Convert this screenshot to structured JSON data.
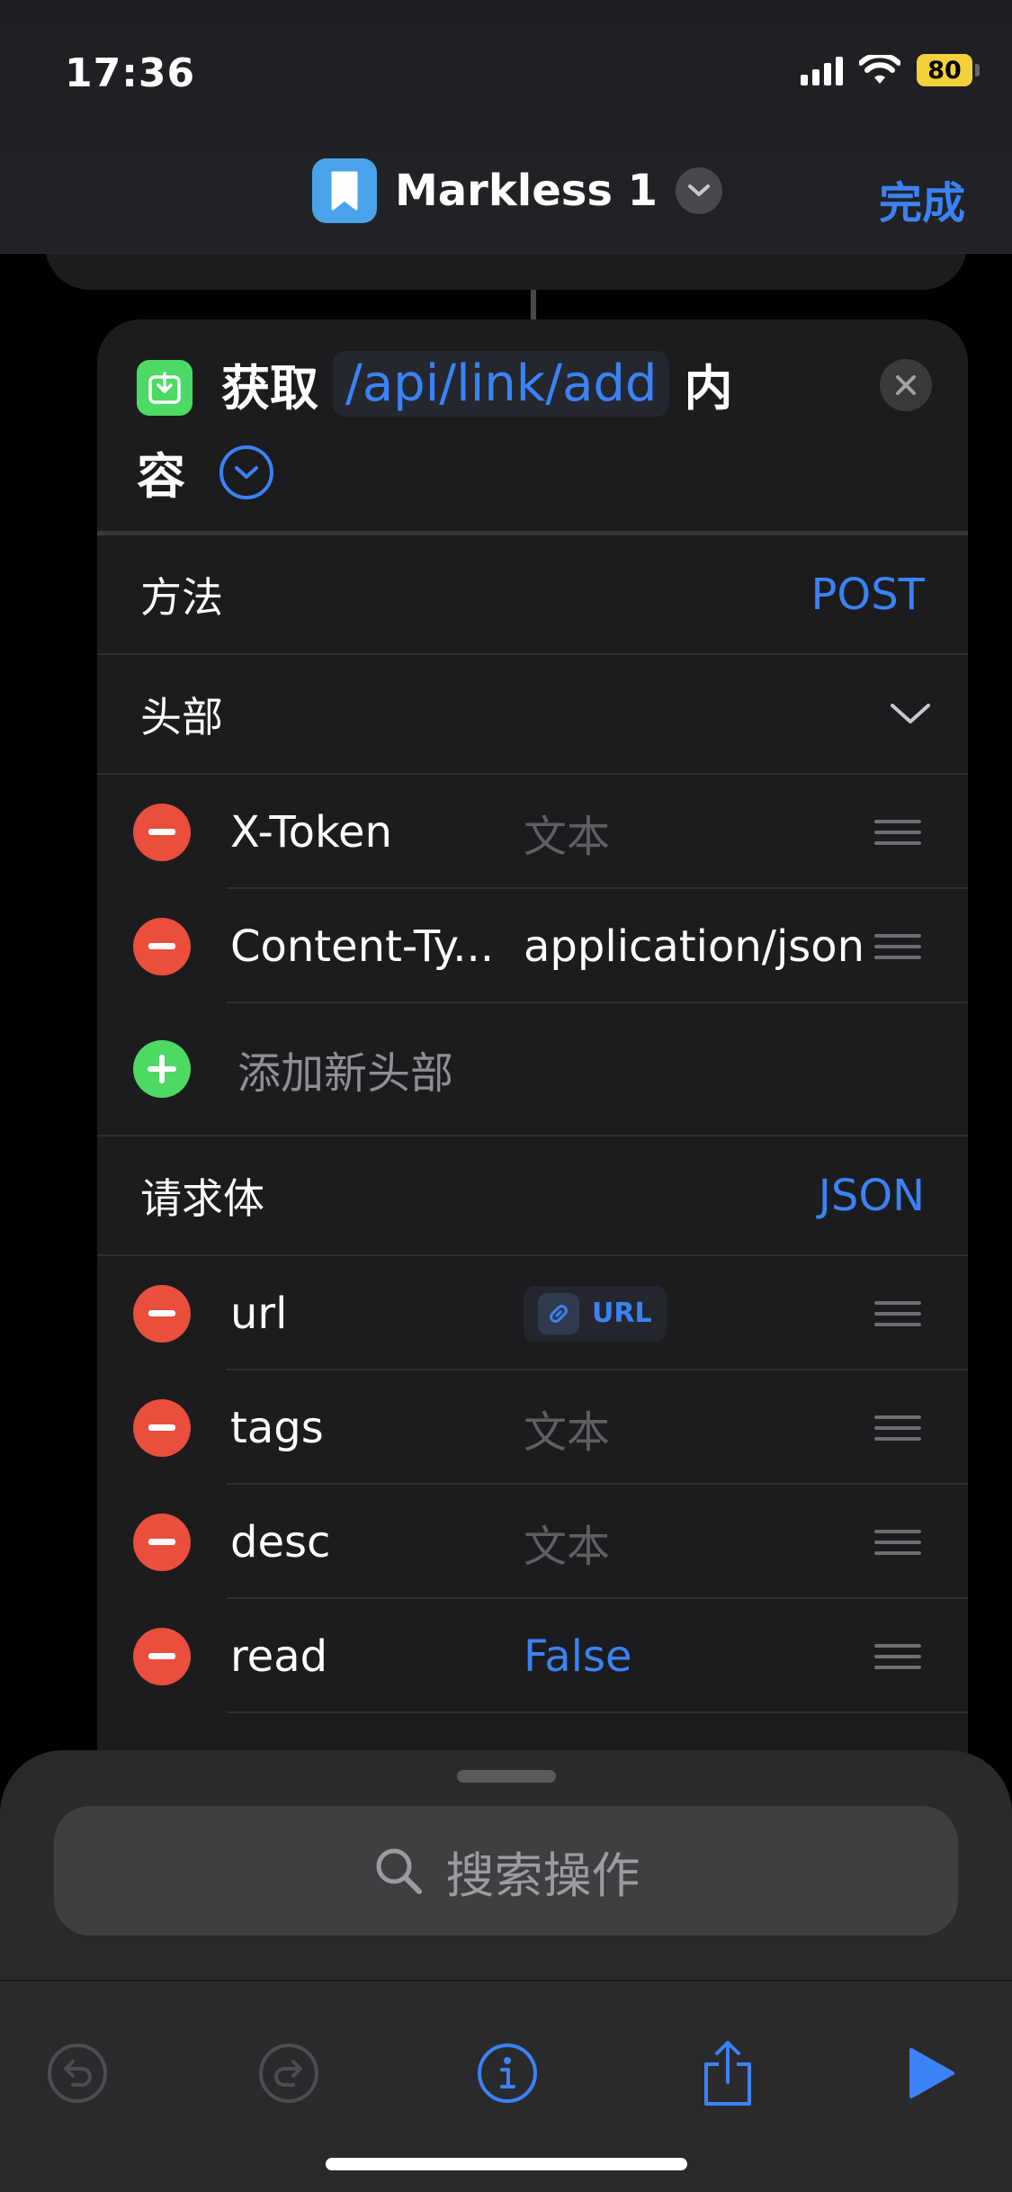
{
  "status": {
    "time": "17:36",
    "battery": "80"
  },
  "nav": {
    "title": "Markless 1",
    "done_label": "完成"
  },
  "action": {
    "verb": "获取",
    "url_token": "/api/link/add",
    "suffix_1": "内",
    "suffix_2": "容"
  },
  "method": {
    "label": "方法",
    "value": "POST"
  },
  "headers": {
    "label": "头部",
    "items": [
      {
        "key": "X-Token",
        "value": "文本",
        "is_placeholder": true
      },
      {
        "key": "Content-Ty...",
        "value": "application/json",
        "is_placeholder": false
      }
    ],
    "add_label": "添加新头部"
  },
  "body": {
    "label": "请求体",
    "type": "JSON",
    "items": [
      {
        "key": "url",
        "chip_label": "URL"
      },
      {
        "key": "tags",
        "value": "文本"
      },
      {
        "key": "desc",
        "value": "文本"
      },
      {
        "key": "read",
        "value": "False"
      }
    ]
  },
  "search": {
    "placeholder": "搜索操作"
  },
  "colors": {
    "accent": "#3b82f6",
    "delete": "#ea4e3d",
    "add": "#4cd964",
    "battery": "#f2d13b"
  }
}
